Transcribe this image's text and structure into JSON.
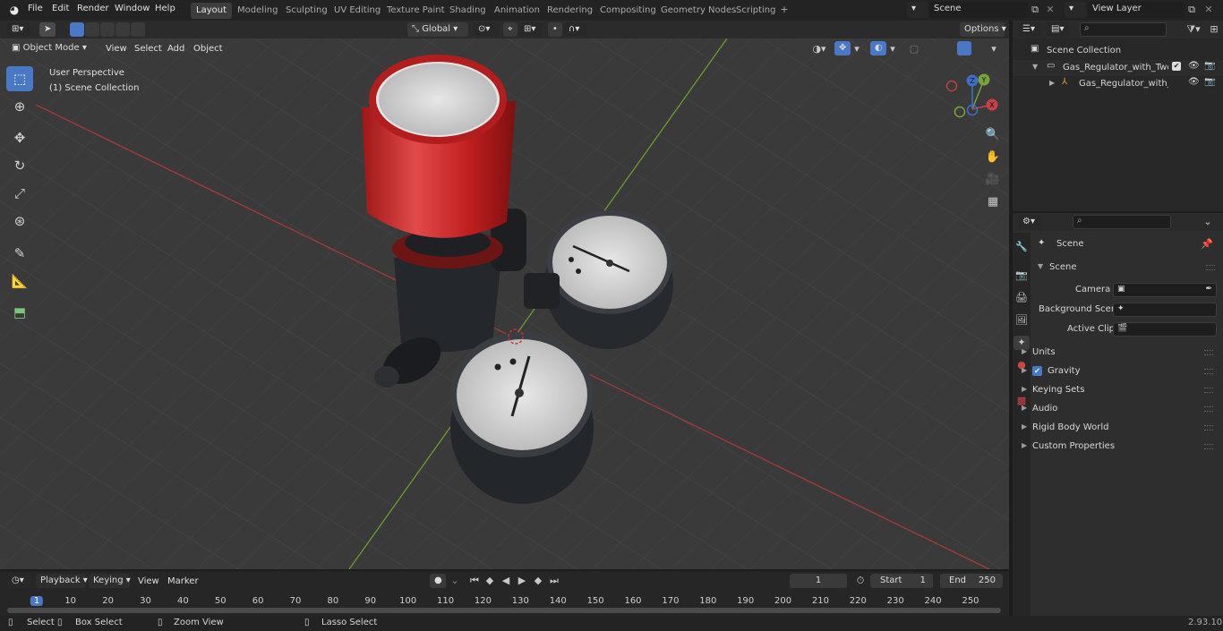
{
  "top_menu": {
    "file": "File",
    "edit": "Edit",
    "render": "Render",
    "window": "Window",
    "help": "Help"
  },
  "workspace_tabs": [
    "Layout",
    "Modeling",
    "Sculpting",
    "UV Editing",
    "Texture Paint",
    "Shading",
    "Animation",
    "Rendering",
    "Compositing",
    "Geometry Nodes",
    "Scripting"
  ],
  "active_tab": "Layout",
  "scene_name": "Scene",
  "view_layer": "View Layer",
  "viewport_header": {
    "mode": "Object Mode",
    "view": "View",
    "select": "Select",
    "add": "Add",
    "object": "Object",
    "orientation": "Global",
    "options": "Options"
  },
  "viewport_overlay": {
    "perspective": "User Perspective",
    "collection": "(1) Scene Collection"
  },
  "gizmo": {
    "x": "X",
    "y": "Y",
    "z": "Z"
  },
  "outliner": {
    "root": "Scene Collection",
    "items": [
      {
        "label": "Gas_Regulator_with_Two_Gau"
      },
      {
        "label": "Gas_Regulator_with_Two"
      }
    ]
  },
  "properties": {
    "breadcrumb": "Scene",
    "section": "Scene",
    "camera_label": "Camera",
    "bg_scene_label": "Background Scene",
    "active_clip_label": "Active Clip",
    "panels": [
      {
        "label": "Units"
      },
      {
        "label": "Gravity",
        "checkbox": true
      },
      {
        "label": "Keying Sets"
      },
      {
        "label": "Audio"
      },
      {
        "label": "Rigid Body World"
      },
      {
        "label": "Custom Properties"
      }
    ]
  },
  "timeline": {
    "playback": "Playback",
    "keying": "Keying",
    "view": "View",
    "marker": "Marker",
    "current_frame": "1",
    "start_label": "Start",
    "start_value": "1",
    "end_label": "End",
    "end_value": "250",
    "ticks": [
      "1",
      "10",
      "20",
      "30",
      "40",
      "50",
      "60",
      "70",
      "80",
      "90",
      "100",
      "110",
      "120",
      "130",
      "140",
      "150",
      "160",
      "170",
      "180",
      "190",
      "200",
      "210",
      "220",
      "230",
      "240",
      "250"
    ]
  },
  "status": {
    "select": "Select",
    "box_select": "Box Select",
    "zoom_view": "Zoom View",
    "lasso_select": "Lasso Select",
    "version": "2.93.10"
  }
}
